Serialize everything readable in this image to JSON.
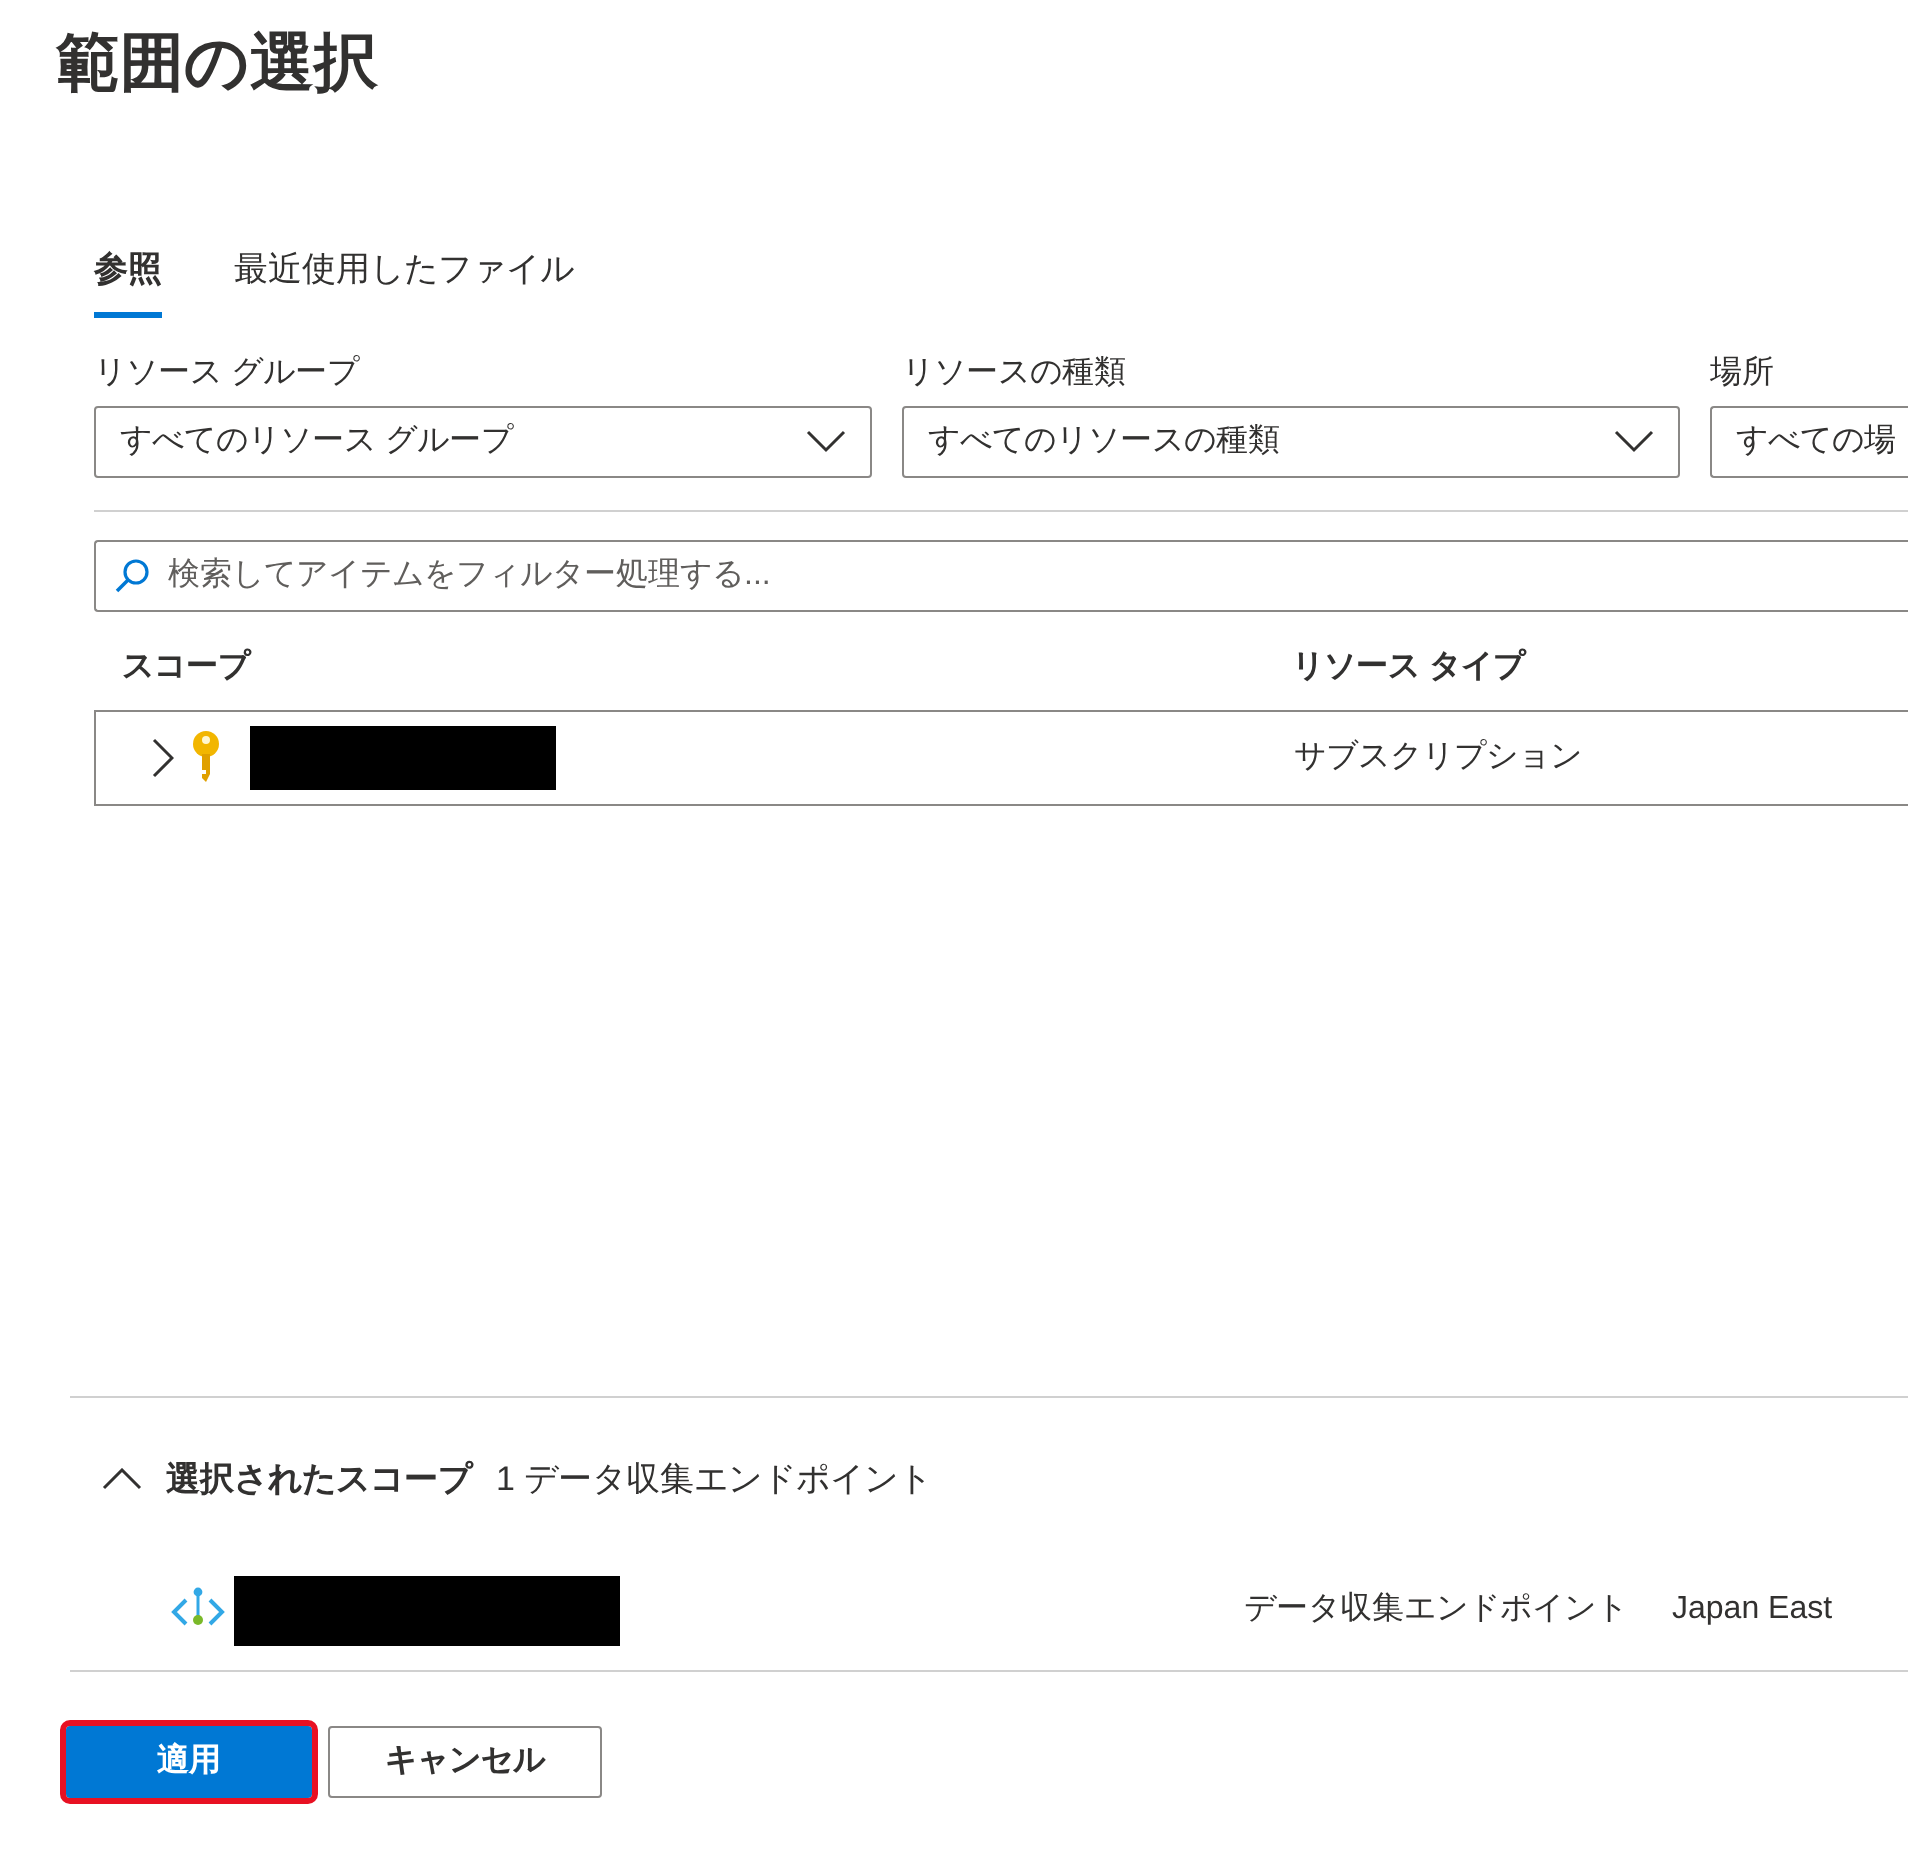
{
  "title": "範囲の選択",
  "tabs": [
    {
      "label": "参照",
      "selected": true
    },
    {
      "label": "最近使用したファイル",
      "selected": false
    }
  ],
  "filters": [
    {
      "label": "リソース グループ",
      "value": "すべてのリソース グループ"
    },
    {
      "label": "リソースの種類",
      "value": "すべてのリソースの種類"
    },
    {
      "label": "場所",
      "value": "すべての場"
    }
  ],
  "search": {
    "placeholder": "検索してアイテムをフィルター処理する..."
  },
  "table": {
    "columns": [
      "スコープ",
      "リソース タイプ"
    ],
    "rows": [
      {
        "expanded": false,
        "resource_type": "サブスクリプション"
      }
    ]
  },
  "selected_scope": {
    "expanded": true,
    "title": "選択されたスコープ",
    "count": "1 データ収集エンドポイント",
    "items": [
      {
        "resource_type": "データ収集エンドポイント",
        "location": "Japan East"
      }
    ]
  },
  "buttons": [
    {
      "label": "適用",
      "kind": "primary",
      "highlighted": true
    },
    {
      "label": "キャンセル",
      "kind": "secondary",
      "highlighted": false
    }
  ]
}
